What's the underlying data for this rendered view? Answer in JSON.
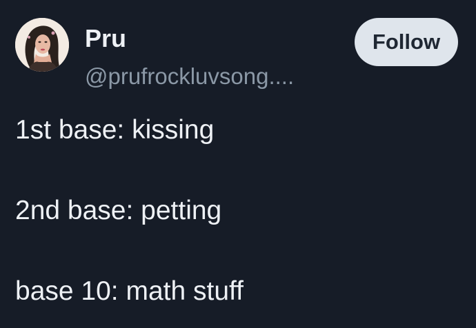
{
  "author": {
    "display_name": "Pru",
    "handle": "@prufrockluvsong....",
    "avatar_icon": "profile-photo-avatar"
  },
  "follow_button": {
    "label": "Follow"
  },
  "tweet": {
    "lines": [
      "1st base: kissing",
      "2nd base: petting",
      "base 10: math stuff"
    ]
  },
  "colors": {
    "background": "#161c27",
    "text_primary": "#eef1f5",
    "text_secondary": "#8b98a6",
    "button_background": "#dfe5ec",
    "button_text": "#1f2733"
  }
}
